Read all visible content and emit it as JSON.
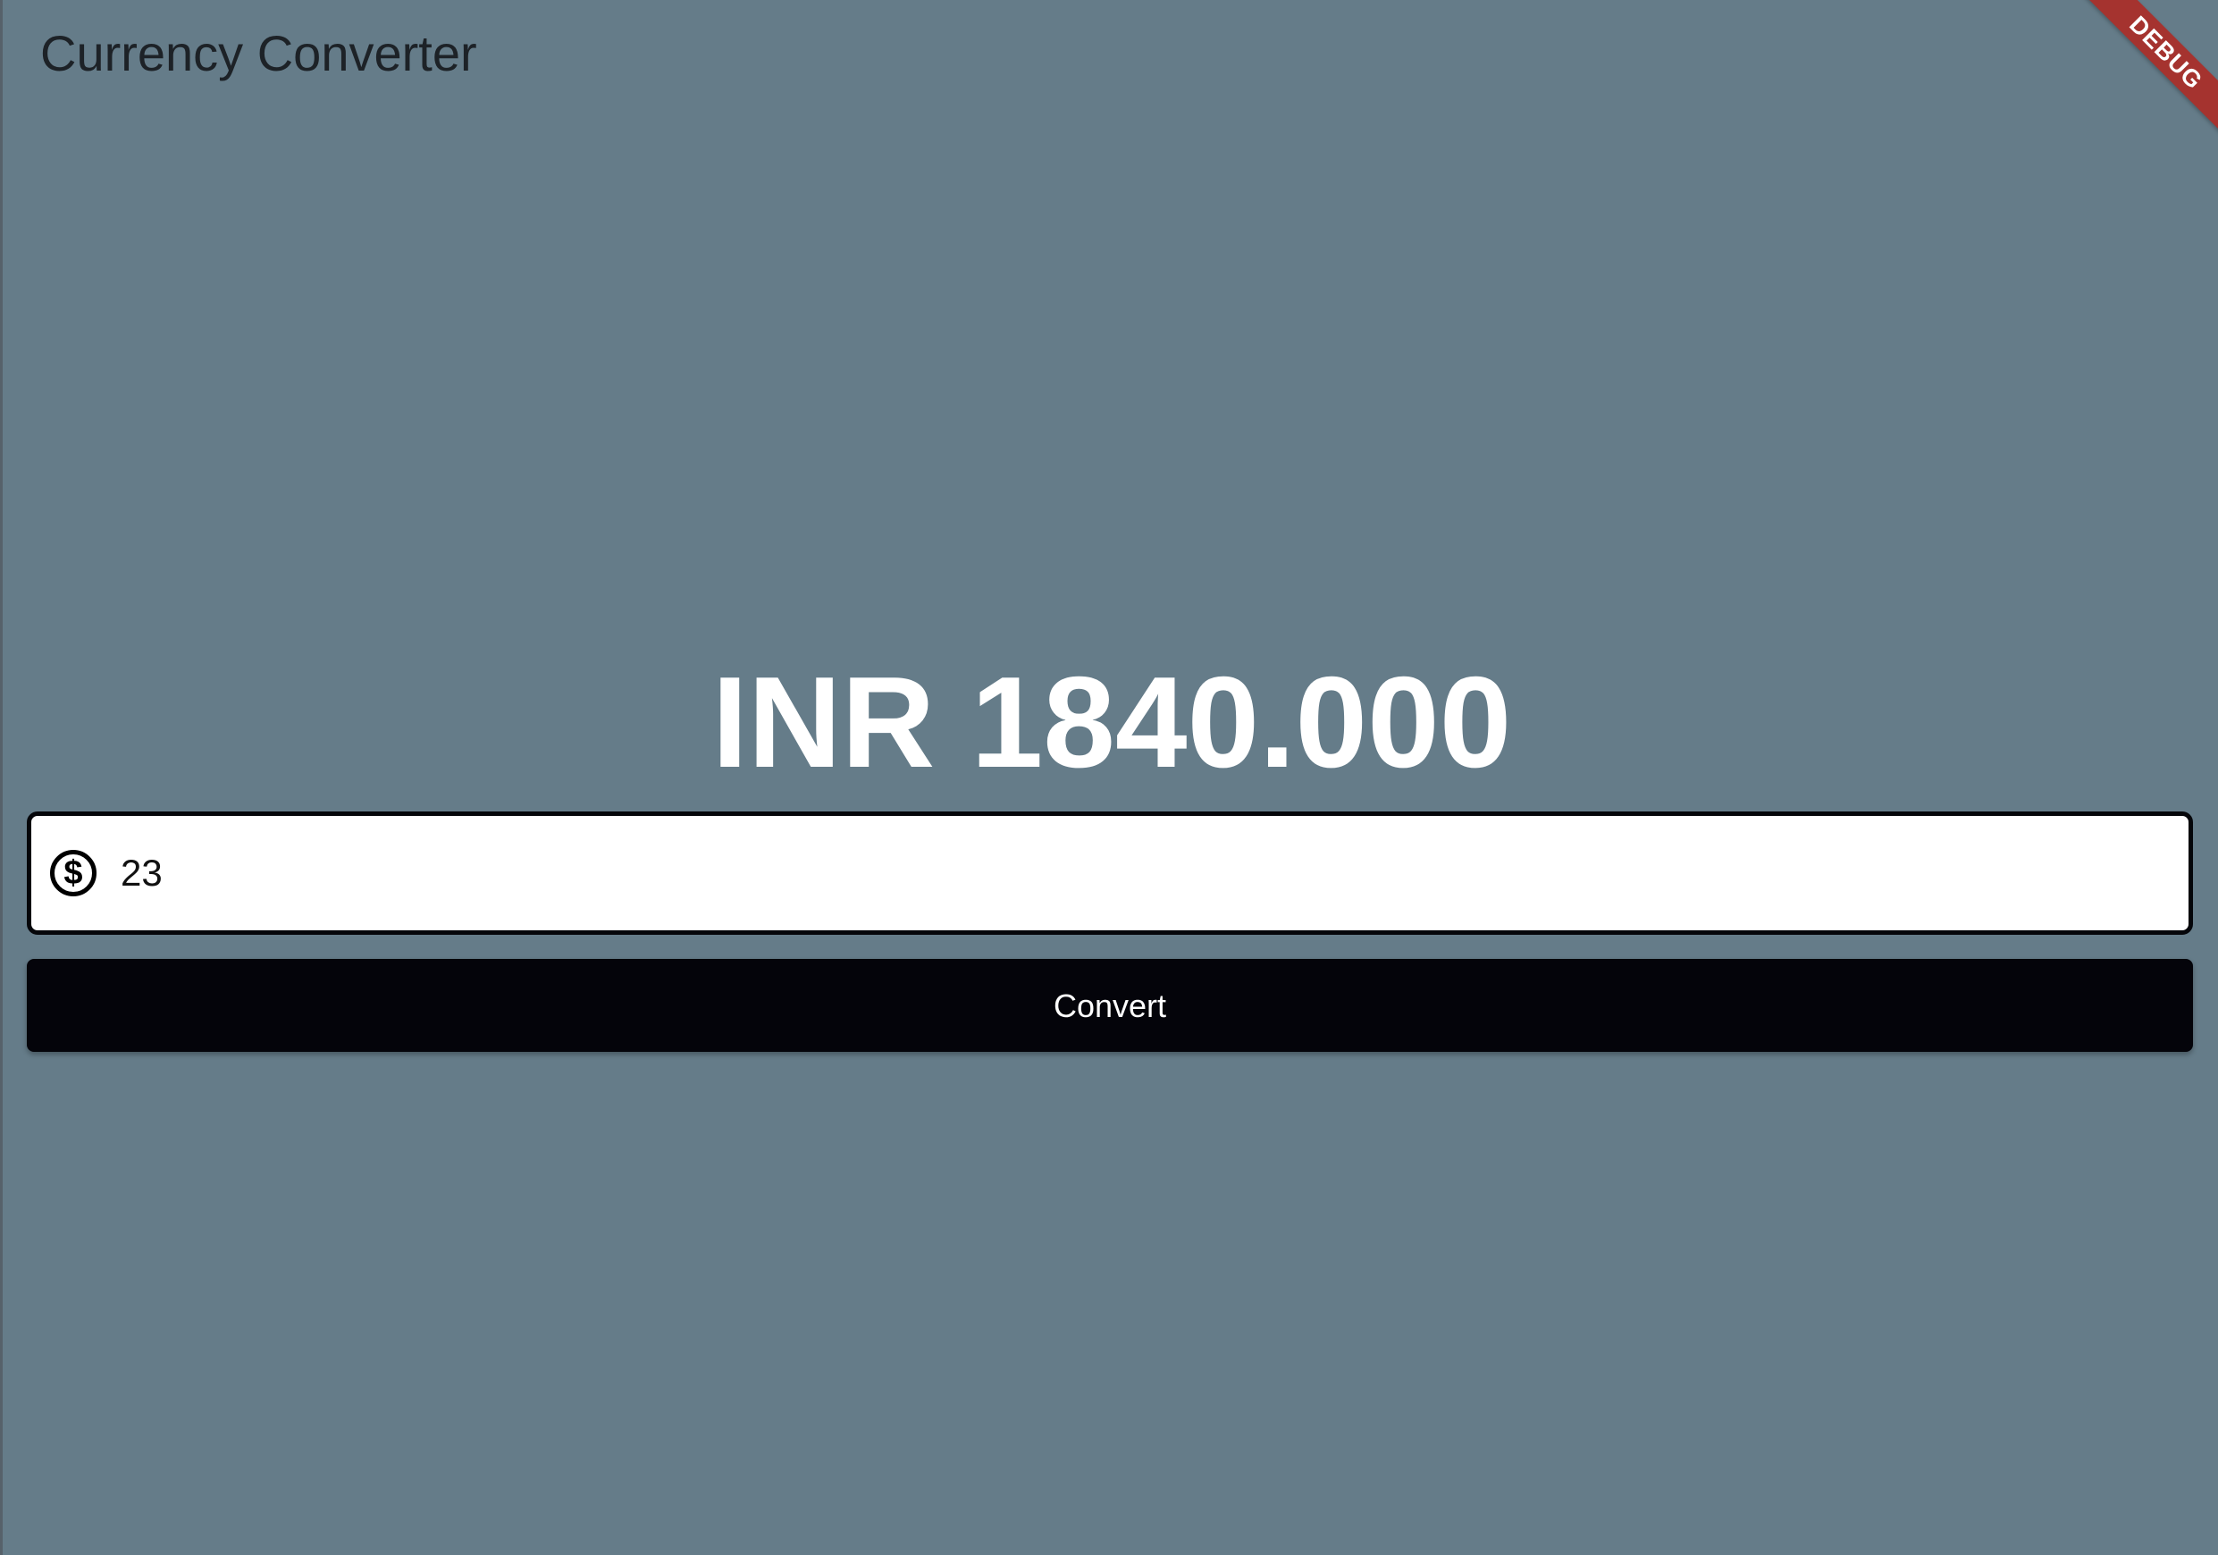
{
  "appbar": {
    "title": "Currency Converter"
  },
  "debug_banner": {
    "label": "DEBUG"
  },
  "result": {
    "text": "INR 1840.000"
  },
  "amount_field": {
    "value": "23",
    "icon": "dollar-circle-icon",
    "icon_glyph": "$"
  },
  "convert_button": {
    "label": "Convert"
  },
  "colors": {
    "background": "#657c89",
    "field_background": "#ffffff",
    "field_border": "#05060a",
    "button_background": "#04040a",
    "button_text": "#ffffff",
    "result_text": "#ffffff",
    "title_text": "#1d2227",
    "debug_ribbon": "#a5332f"
  }
}
